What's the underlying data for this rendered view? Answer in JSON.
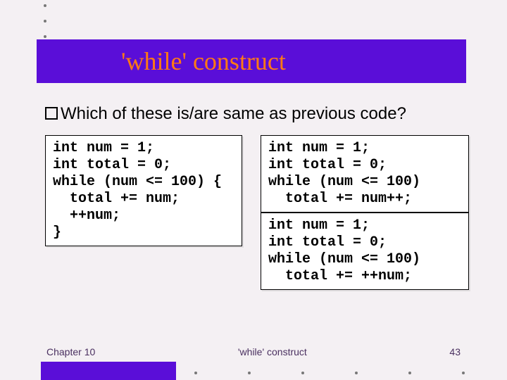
{
  "title": "'while' construct",
  "question": "Which of these is/are same as previous code?",
  "code_left": "int num = 1;\nint total = 0;\nwhile (num <= 100) {\n  total += num;\n  ++num;\n}",
  "code_right_top": "int num = 1;\nint total = 0;\nwhile (num <= 100)\n  total += num++;",
  "code_right_bottom": "int num = 1;\nint total = 0;\nwhile (num <= 100)\n  total += ++num;",
  "footer": {
    "left": "Chapter 10",
    "center": "'while' construct",
    "right": "43"
  }
}
